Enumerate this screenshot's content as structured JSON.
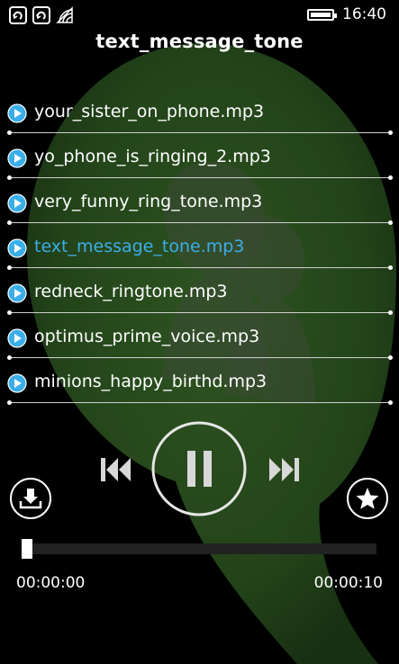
{
  "status_bar": {
    "icons": [
      "sync-icon",
      "sync-icon",
      "wifi-icon"
    ],
    "battery_level": 1.0,
    "time": "16:40"
  },
  "player": {
    "title": "text_message_tone",
    "tracks": [
      {
        "name": "your_sister_on_phone.mp3",
        "active": false
      },
      {
        "name": "yo_phone_is_ringing_2.mp3",
        "active": false
      },
      {
        "name": "very_funny_ring_tone.mp3",
        "active": false
      },
      {
        "name": "text_message_tone.mp3",
        "active": true
      },
      {
        "name": "redneck_ringtone.mp3",
        "active": false
      },
      {
        "name": "optimus_prime_voice.mp3",
        "active": false
      },
      {
        "name": "minions_happy_birthd.mp3",
        "active": false
      }
    ],
    "controls": {
      "prev_icon": "skip-previous-icon",
      "play_pause_icon": "pause-icon",
      "next_icon": "skip-next-icon",
      "download_icon": "download-icon",
      "favorite_icon": "star-icon"
    },
    "progress": 0.0,
    "current_time": "00:00:00",
    "total_time": "00:00:10"
  },
  "colors": {
    "accent": "#3aaee9",
    "background": "#000000",
    "art_green": "#1e3a14"
  }
}
